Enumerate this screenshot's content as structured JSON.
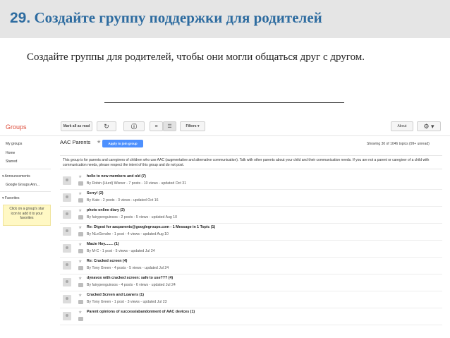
{
  "slide": {
    "number": "29.",
    "title": "Создайте группу поддержки для родителей",
    "subtitle": "Создайте группы для родителей, чтобы они могли общаться друг с другом."
  },
  "app": {
    "logo": "Groups",
    "toolbar": {
      "mark_all_read": "Mark all as read",
      "refresh_icon": "↻",
      "info_icon": "ⓘ",
      "list_view_icon": "≡",
      "compact_view_icon": "☰",
      "filters": "Filters ▾",
      "about": "About",
      "settings_icon": "⚙ ▾"
    },
    "sidebar": {
      "items": [
        "My groups",
        "Home",
        "Starred"
      ],
      "announcements_header": "▾ Announcements",
      "announcements_item": "Google Groups Ann...",
      "favorites_header": "▾ Favorites",
      "favorites_hint": [
        "Click on a group's star",
        "icon to add it to your",
        "favorites"
      ]
    },
    "group": {
      "name": "AAC Parents",
      "star_icon": "★",
      "join_button": "Apply to join group",
      "showing": "Showing 30 of 1046 topics (99+ unread)",
      "description": "This group is for parents and caregivers of children who use AAC (augmentative and alternative communication). Talk with other parents about your child and their communication needs. If you are not a parent or caregiver of a child with communication needs, please respect the intent of this group and do not post."
    },
    "topics": [
      {
        "title": "hello to new members and old  (7)",
        "meta": "By Robin (Hurd) Wisner - 7 posts - 10 views - updated Oct 31"
      },
      {
        "title": "Sorry!  (2)",
        "meta": "By Kate - 2 posts - 3 views - updated Oct 16"
      },
      {
        "title": "photo online diary  (2)",
        "meta": "By fairypenguinsos - 2 posts - 5 views - updated Aug 10"
      },
      {
        "title": "Re: Digest for aacparents@googlegroups.com - 1 Message in 1 Topic  (1)",
        "meta": "By NLeGendre - 1 post - 4 views - updated Aug 10"
      },
      {
        "title": "Macie Hoy........  (1)",
        "meta": "By M-C - 1 post - 5 views - updated Jul 24"
      },
      {
        "title": "Re: Cracked screen  (4)",
        "meta": "By Tony Green - 4 posts - 5 views - updated Jul 24"
      },
      {
        "title": "dynavox with cracked screen: safe to use???  (4)",
        "meta": "By fairypenguinsos - 4 posts - 6 views - updated Jul 24"
      },
      {
        "title": "Cracked Screen and Loaners  (1)",
        "meta": "By Tony Green - 1 post - 3 views - updated Jul 23"
      },
      {
        "title": "Parent opinions of success/abandonment of AAC devices  (1)",
        "meta": ""
      }
    ]
  }
}
